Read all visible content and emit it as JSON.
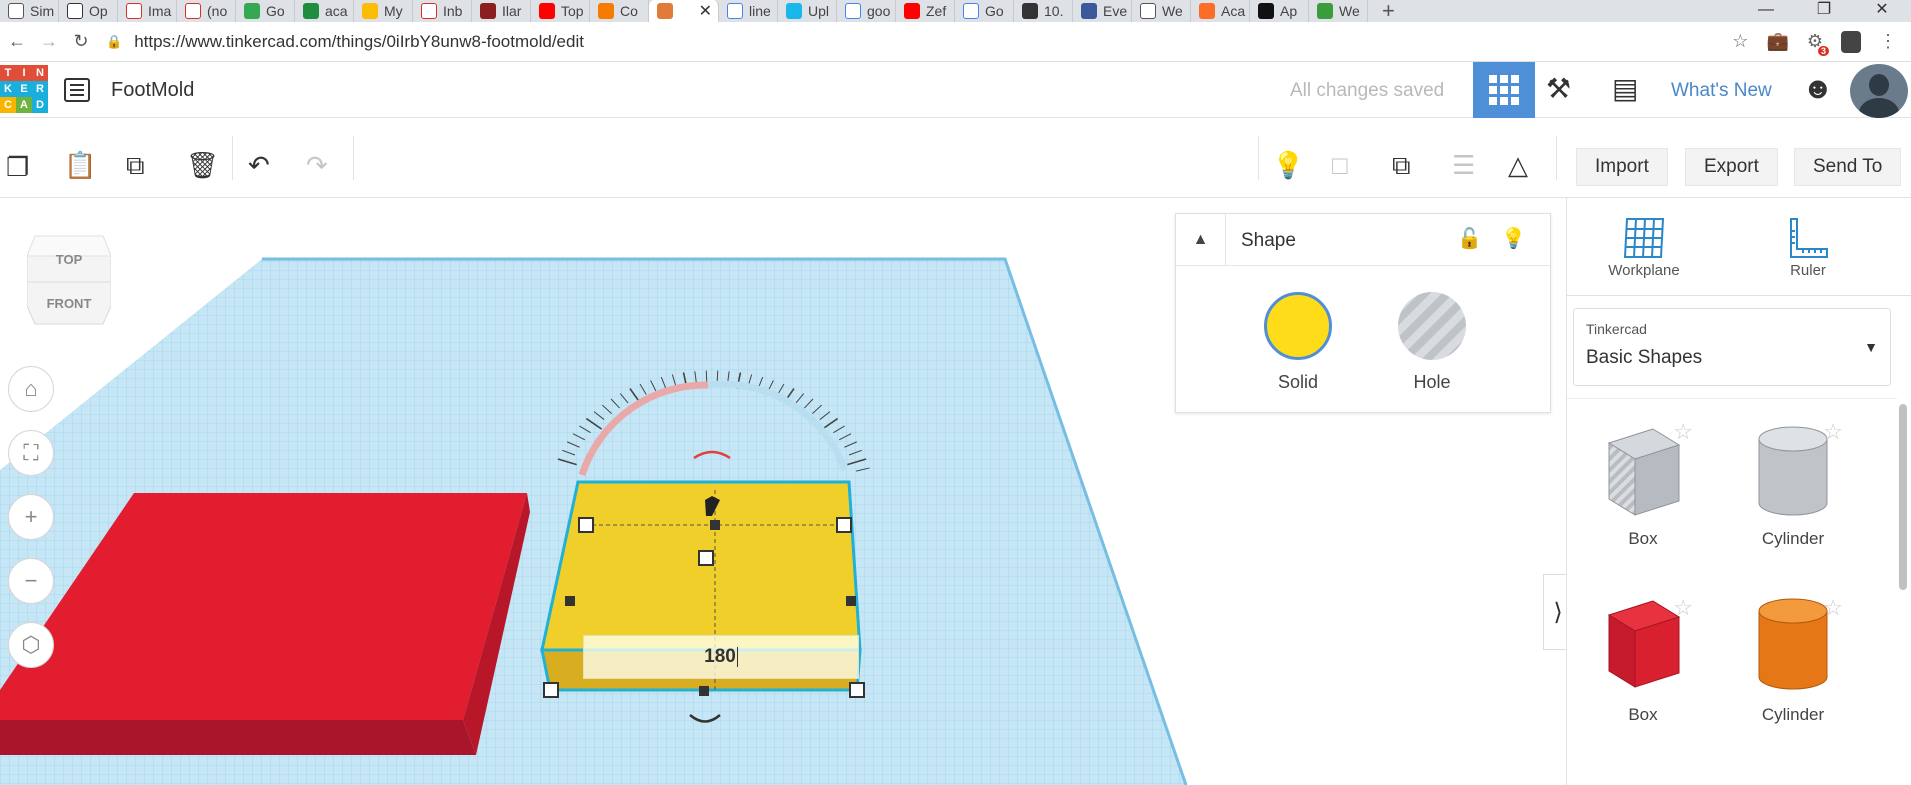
{
  "browser": {
    "tabs": [
      {
        "label": "Sim",
        "color": "#ffffff",
        "fg": "#555"
      },
      {
        "label": "Op",
        "color": "#ffffff",
        "fg": "#333"
      },
      {
        "label": "Ima",
        "color": "#ffffff",
        "fg": "#d93025"
      },
      {
        "label": "(no",
        "color": "#ffffff",
        "fg": "#d93025"
      },
      {
        "label": "Go",
        "color": "#34a853",
        "fg": "#fff"
      },
      {
        "label": "aca",
        "color": "#1e8e3e",
        "fg": "#fff"
      },
      {
        "label": "My",
        "color": "#fbbc04",
        "fg": "#fff"
      },
      {
        "label": "Inb",
        "color": "#ffffff",
        "fg": "#d93025"
      },
      {
        "label": "Ilar",
        "color": "#8b1e1e",
        "fg": "#fff"
      },
      {
        "label": "Top",
        "color": "#ff0000",
        "fg": "#fff"
      },
      {
        "label": "Co",
        "color": "#f57c00",
        "fg": "#fff"
      },
      {
        "label": "",
        "color": "#e07b39",
        "fg": "#fff"
      },
      {
        "label": "line",
        "color": "#ffffff",
        "fg": "#4285f4"
      },
      {
        "label": "Upl",
        "color": "#1ab7ea",
        "fg": "#fff"
      },
      {
        "label": "goo",
        "color": "#ffffff",
        "fg": "#4285f4"
      },
      {
        "label": "Zef",
        "color": "#ff0000",
        "fg": "#fff"
      },
      {
        "label": "Go",
        "color": "#ffffff",
        "fg": "#4285f4"
      },
      {
        "label": "10.",
        "color": "#333333",
        "fg": "#fff"
      },
      {
        "label": "Eve",
        "color": "#3b5998",
        "fg": "#fff"
      },
      {
        "label": "We",
        "color": "#ffffff",
        "fg": "#555"
      },
      {
        "label": "Aca",
        "color": "#fc6d26",
        "fg": "#fff"
      },
      {
        "label": "Ap",
        "color": "#111111",
        "fg": "#fff"
      },
      {
        "label": "We",
        "color": "#3b9c3b",
        "fg": "#fff"
      }
    ],
    "active_tab_index": 11,
    "url": "https://www.tinkercad.com/things/0iIrbY8unw8-footmold/edit",
    "extension_badge": "3"
  },
  "app": {
    "logo_letters": [
      "T",
      "I",
      "N",
      "K",
      "E",
      "R",
      "C",
      "A",
      "D"
    ],
    "logo_colors": [
      "#e04e39",
      "#e04e39",
      "#e04e39",
      "#1aaedc",
      "#1aaedc",
      "#1aaedc",
      "#f7b500",
      "#6cb33f",
      "#1aaedc"
    ],
    "doc_title": "FootMold",
    "save_status": "All changes saved",
    "whats_new": "What's New"
  },
  "toolbar": {
    "import_label": "Import",
    "export_label": "Export",
    "send_to_label": "Send To"
  },
  "viewcube": {
    "top_label": "TOP",
    "front_label": "FRONT"
  },
  "rotation_input": {
    "value": "180"
  },
  "shape_panel": {
    "title": "Shape",
    "solid_label": "Solid",
    "hole_label": "Hole",
    "solid_color": "#ffdc1a"
  },
  "library": {
    "workplane_label": "Workplane",
    "ruler_label": "Ruler",
    "category_small": "Tinkercad",
    "category_value": "Basic Shapes",
    "items": [
      {
        "label": "Box",
        "kind": "box-hole"
      },
      {
        "label": "Cylinder",
        "kind": "cylinder-hole"
      },
      {
        "label": "Box",
        "kind": "box-red"
      },
      {
        "label": "Cylinder",
        "kind": "cylinder-orange"
      }
    ]
  }
}
